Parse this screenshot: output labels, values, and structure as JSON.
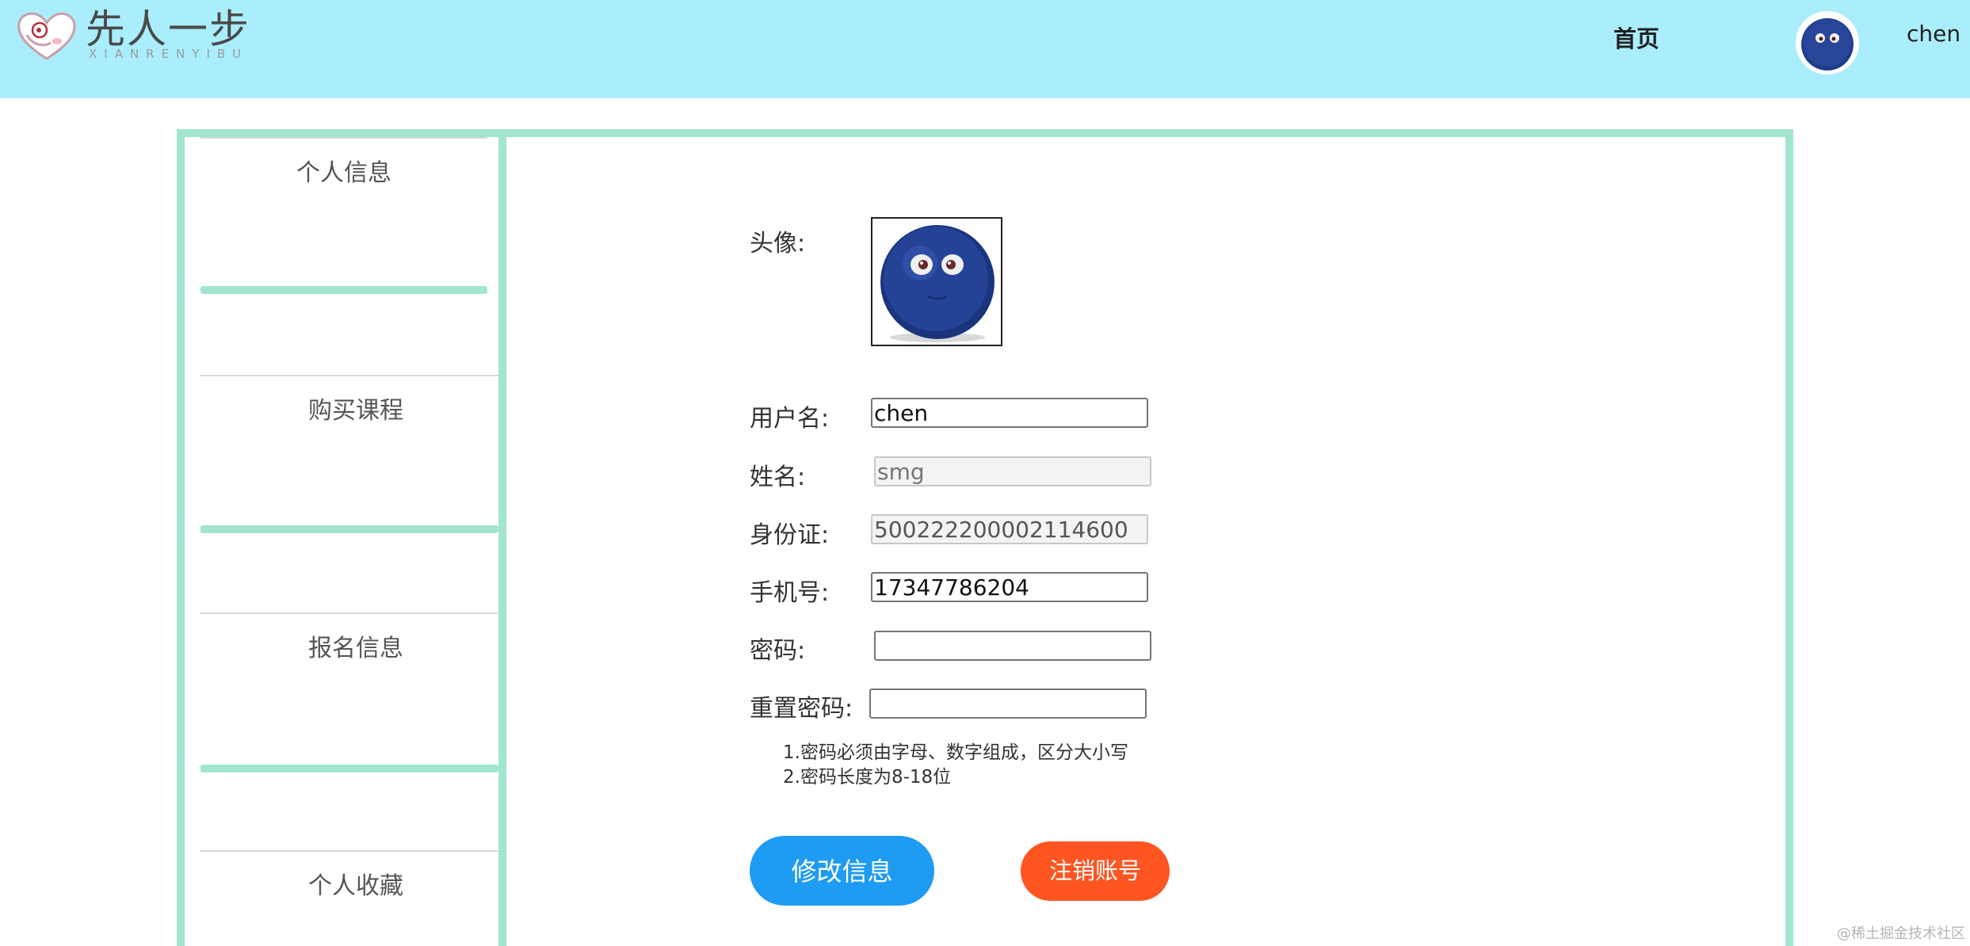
{
  "header": {
    "logo_title": "先人一步",
    "logo_subtitle": "XIANRENYIBU",
    "nav_home": "首页",
    "username": "chen",
    "background_color": "#aaeefd"
  },
  "sidebar": {
    "items": [
      {
        "label": "个人信息"
      },
      {
        "label": "购买课程"
      },
      {
        "label": "报名信息"
      },
      {
        "label": "个人收藏"
      }
    ],
    "accent_color": "#a2e6cf"
  },
  "form": {
    "avatar_label": "头像:",
    "username_label": "用户名:",
    "username_value": "chen",
    "name_label": "姓名:",
    "name_placeholder": "smg",
    "id_label": "身份证:",
    "id_value": "500222200002114600",
    "phone_label": "手机号:",
    "phone_value": "17347786204",
    "password_label": "密码:",
    "password_value": "",
    "confirm_label": "重置密码:",
    "confirm_value": "",
    "hint_1": "1.密码必须由字母、数字组成，区分大小写",
    "hint_2": "2.密码长度为8-18位"
  },
  "buttons": {
    "edit_label": "修改信息",
    "edit_color": "#1e9bf3",
    "cancel_label": "注销账号",
    "cancel_color": "#ff5521"
  },
  "watermark": "@稀土掘金技术社区"
}
